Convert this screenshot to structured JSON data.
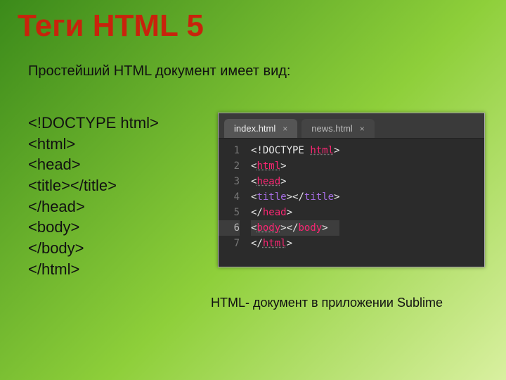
{
  "title": "Теги HTML 5",
  "intro": "Простейший HTML документ имеет вид:",
  "code_plain": [
    "<!DOCTYPE html>",
    "<html>",
    "<head>",
    "<title></title>",
    "</head>",
    "<body>",
    "</body>",
    "</html>"
  ],
  "caption": "HTML- документ в приложении Sublime",
  "editor": {
    "tabs": [
      {
        "label": "index.html",
        "active": true
      },
      {
        "label": "news.html",
        "active": false
      }
    ],
    "highlighted_line": 6,
    "lines": [
      {
        "n": 1,
        "tokens": [
          {
            "t": "<!",
            "c": "br"
          },
          {
            "t": "DOCTYPE",
            "c": "doctype"
          },
          {
            "t": " ",
            "c": "doctype"
          },
          {
            "t": "html",
            "c": "doctkw"
          },
          {
            "t": ">",
            "c": "br"
          }
        ]
      },
      {
        "n": 2,
        "tokens": [
          {
            "t": "<",
            "c": "br"
          },
          {
            "t": "html",
            "c": "tag tag-dotted"
          },
          {
            "t": ">",
            "c": "br"
          }
        ]
      },
      {
        "n": 3,
        "tokens": [
          {
            "t": "<",
            "c": "br"
          },
          {
            "t": "head",
            "c": "tag tag-dotted"
          },
          {
            "t": ">",
            "c": "br"
          }
        ]
      },
      {
        "n": 4,
        "tokens": [
          {
            "t": "<",
            "c": "br"
          },
          {
            "t": "title",
            "c": "tag-title"
          },
          {
            "t": ">",
            "c": "br"
          },
          {
            "t": "</",
            "c": "br"
          },
          {
            "t": "title",
            "c": "tag-title"
          },
          {
            "t": ">",
            "c": "br"
          }
        ]
      },
      {
        "n": 5,
        "tokens": [
          {
            "t": "</",
            "c": "br"
          },
          {
            "t": "head",
            "c": "tag"
          },
          {
            "t": ">",
            "c": "br"
          }
        ]
      },
      {
        "n": 6,
        "tokens": [
          {
            "t": "<",
            "c": "br"
          },
          {
            "t": "body",
            "c": "tag tag-dotted"
          },
          {
            "t": ">",
            "c": "br"
          },
          {
            "t": "</",
            "c": "br"
          },
          {
            "t": "body",
            "c": "tag"
          },
          {
            "t": ">",
            "c": "br"
          }
        ]
      },
      {
        "n": 7,
        "tokens": [
          {
            "t": "</",
            "c": "br"
          },
          {
            "t": "html",
            "c": "tag tag-dotted"
          },
          {
            "t": ">",
            "c": "br"
          }
        ]
      }
    ]
  }
}
